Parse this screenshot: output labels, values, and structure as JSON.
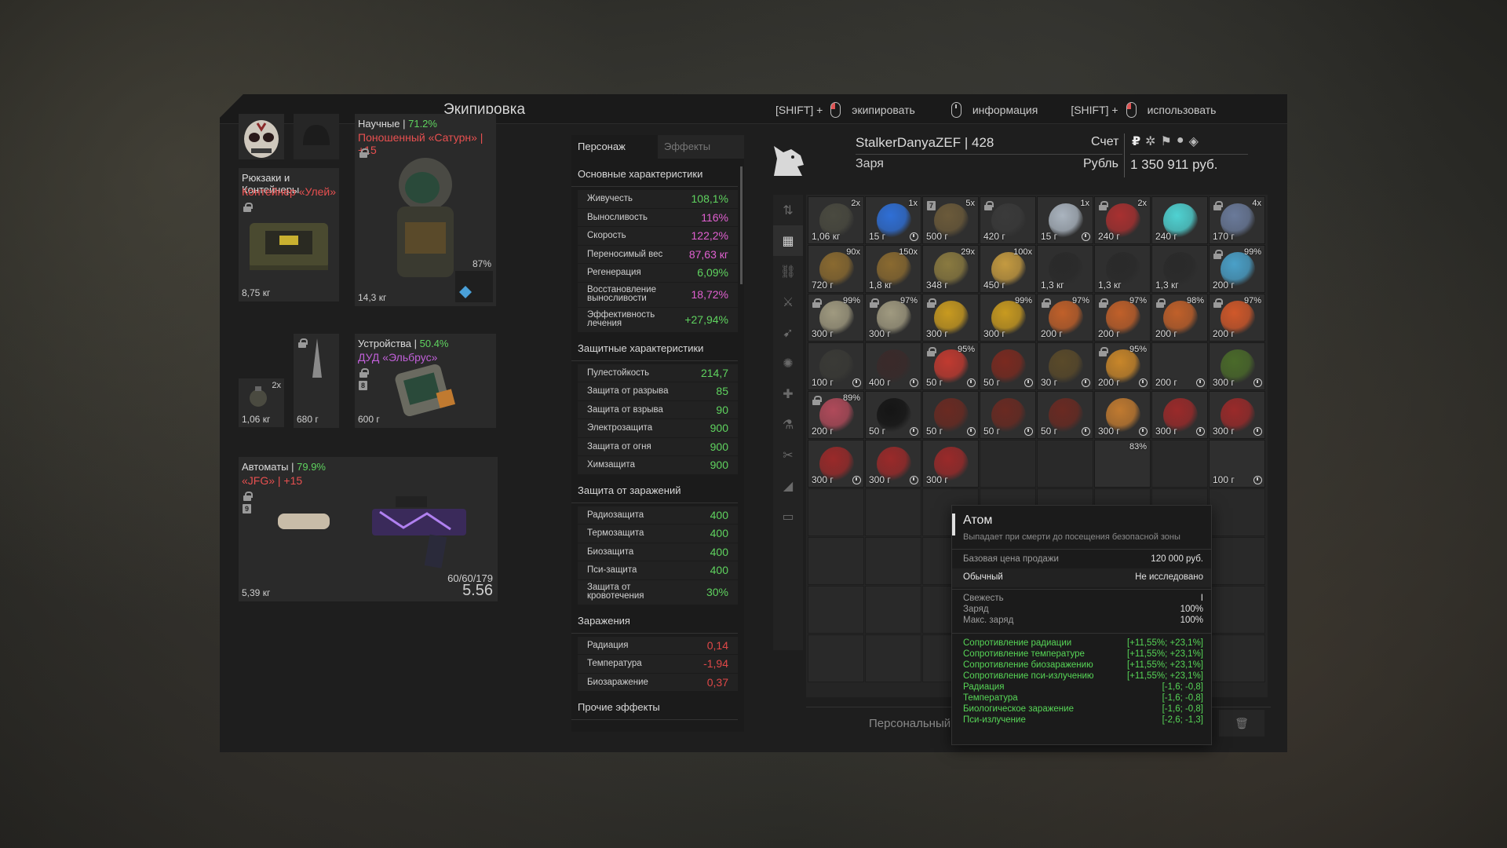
{
  "window": {
    "title": "Экипировка"
  },
  "hints": [
    {
      "prefix": "[SHIFT] +",
      "label": "экипировать",
      "mouse": "left"
    },
    {
      "prefix": "",
      "label": "информация",
      "mouse": "mid"
    },
    {
      "prefix": "[SHIFT] +",
      "label": "использовать",
      "mouse": "left"
    }
  ],
  "equipment": {
    "backpack": {
      "label": "Рюкзаки и Контейнеры",
      "name": "Контейнер «Улей»",
      "weight": "8,75 кг"
    },
    "armor": {
      "label": "Научные",
      "pct": "71.2%",
      "name": "Поношенный «Сатурн» | +15",
      "weight": "14,3 кг",
      "slot_pct": "87%"
    },
    "grenade": {
      "count": "2x",
      "weight": "1,06 кг"
    },
    "knife": {
      "weight": "680 г"
    },
    "device": {
      "label": "Устройства",
      "pct": "50.4%",
      "name": "ДУД «Эльбрус»",
      "badge": "8",
      "weight": "600 г"
    },
    "weapon": {
      "label": "Автоматы",
      "pct": "79.9%",
      "name": "«JFG» | +15",
      "badge": "9",
      "ammo": "60/60/179",
      "caliber": "5.56",
      "weight": "5,39 кг"
    }
  },
  "stats": {
    "tabs": [
      "Персонаж",
      "Эффекты"
    ],
    "main_title": "Основные характеристики",
    "main": [
      {
        "k": "Живучесть",
        "v": "108,1%",
        "c": "green"
      },
      {
        "k": "Выносливость",
        "v": "116%",
        "c": "pink"
      },
      {
        "k": "Скорость",
        "v": "122,2%",
        "c": "pink"
      },
      {
        "k": "Переносимый вес",
        "v": "87,63 кг",
        "c": "pink"
      },
      {
        "k": "Регенерация",
        "v": "6,09%",
        "c": "green"
      },
      {
        "k": "Восстановление выносливости",
        "v": "18,72%",
        "c": "pink",
        "tall": true
      },
      {
        "k": "Эффективность лечения",
        "v": "+27,94%",
        "c": "green",
        "tall": true
      }
    ],
    "prot_title": "Защитные характеристики",
    "prot": [
      {
        "k": "Пулестойкость",
        "v": "214,7"
      },
      {
        "k": "Защита от разрыва",
        "v": "85"
      },
      {
        "k": "Защита от взрыва",
        "v": "90"
      },
      {
        "k": "Электрозащита",
        "v": "900"
      },
      {
        "k": "Защита от огня",
        "v": "900"
      },
      {
        "k": "Химзащита",
        "v": "900"
      }
    ],
    "cont_title": "Защита от заражений",
    "cont": [
      {
        "k": "Радиозащита",
        "v": "400"
      },
      {
        "k": "Термозащита",
        "v": "400"
      },
      {
        "k": "Биозащита",
        "v": "400"
      },
      {
        "k": "Пси-защита",
        "v": "400"
      },
      {
        "k": "Защита от кровотечения",
        "v": "30%",
        "tall": true
      }
    ],
    "inf_title": "Заражения",
    "inf": [
      {
        "k": "Радиация",
        "v": "0,14"
      },
      {
        "k": "Температура",
        "v": "-1,94"
      },
      {
        "k": "Биозаражение",
        "v": "0,37"
      }
    ],
    "other_title": "Прочие эффекты"
  },
  "profile": {
    "name": "StalkerDanyaZEF | 428",
    "faction": "Заря",
    "account_label": "Счет",
    "currency_label": "Рубль",
    "balance": "1 350 911 руб."
  },
  "inventory": [
    [
      {
        "p": "1,06 кг",
        "n": "2x",
        "col": "#4a4a40"
      },
      {
        "p": "15 г",
        "n": "1x",
        "col": "#2f6fd6",
        "clock": true
      },
      {
        "p": "500 г",
        "n": "5x",
        "col": "#6b5a3a",
        "b": "7"
      },
      {
        "p": "420 г",
        "col": "#3a3a3a",
        "lock": true
      },
      {
        "p": "15 г",
        "n": "1x",
        "col": "#aab4bf",
        "clock": true
      },
      {
        "p": "240 г",
        "n": "2x",
        "col": "#a83030",
        "lock": true
      },
      {
        "p": "240 г",
        "col": "#4fd2d2"
      },
      {
        "p": "170 г",
        "n": "4x",
        "col": "#6a7a9a",
        "lock": true
      }
    ],
    [
      {
        "p": "720 г",
        "n": "90x",
        "col": "#8a6a30"
      },
      {
        "p": "1,8 кг",
        "n": "150x",
        "col": "#8a6a30"
      },
      {
        "p": "348 г",
        "n": "29x",
        "col": "#8a7a40"
      },
      {
        "p": "450 г",
        "n": "100x",
        "col": "#c49a40"
      },
      {
        "p": "1,3 кг",
        "col": "#2a2a2a"
      },
      {
        "p": "1,3 кг",
        "col": "#2a2a2a"
      },
      {
        "p": "1,3 кг",
        "col": "#2a2a2a"
      },
      {
        "p": "200 г",
        "n": "99%",
        "col": "#4aa0c8",
        "lock": true
      }
    ],
    [
      {
        "p": "300 г",
        "n": "99%",
        "col": "#a09a80",
        "lock": true
      },
      {
        "p": "300 г",
        "n": "97%",
        "col": "#a09a80",
        "lock": true
      },
      {
        "p": "300 г",
        "col": "#c89a20",
        "lock": true
      },
      {
        "p": "300 г",
        "n": "99%",
        "col": "#c89a20"
      },
      {
        "p": "200 г",
        "n": "97%",
        "col": "#c0602a",
        "lock": true
      },
      {
        "p": "200 г",
        "n": "97%",
        "col": "#c0602a",
        "lock": true
      },
      {
        "p": "200 г",
        "n": "98%",
        "col": "#c0602a",
        "lock": true
      },
      {
        "p": "200 г",
        "n": "97%",
        "col": "#d0582a",
        "lock": true
      }
    ],
    [
      {
        "p": "100 г",
        "col": "#3a3a36",
        "clock": true
      },
      {
        "p": "400 г",
        "col": "#3a2a2a",
        "clock": true
      },
      {
        "p": "50 г",
        "n": "95%",
        "col": "#c03a30",
        "lock": true,
        "clock": true
      },
      {
        "p": "50 г",
        "col": "#7a2a20",
        "clock": true
      },
      {
        "p": "30 г",
        "col": "#5a4a2a",
        "clock": true
      },
      {
        "p": "200 г",
        "n": "95%",
        "col": "#c8862a",
        "lock": true,
        "clock": true
      },
      {
        "p": "200 г",
        "col": "#222",
        "clock": true
      },
      {
        "p": "300 г",
        "col": "#4a6a2a",
        "clock": true
      }
    ],
    [
      {
        "p": "200 г",
        "n": "89%",
        "col": "#b04a5a",
        "lock": true
      },
      {
        "p": "50 г",
        "col": "#151515",
        "clock": true
      },
      {
        "p": "50 г",
        "col": "#6a2a22",
        "clock": true
      },
      {
        "p": "50 г",
        "col": "#6a2a22",
        "clock": true
      },
      {
        "p": "50 г",
        "col": "#6a2a22",
        "clock": true
      },
      {
        "p": "300 г",
        "col": "#c07a30",
        "clock": true
      },
      {
        "p": "300 г",
        "col": "#9a2a2a",
        "clock": true
      },
      {
        "p": "300 г",
        "col": "#9a2a2a",
        "clock": true
      }
    ],
    [
      {
        "p": "300 г",
        "col": "#9a2a2a",
        "clock": true
      },
      {
        "p": "300 г",
        "col": "#9a2a2a",
        "clock": true
      },
      {
        "p": "300 г",
        "col": "#9a2a2a"
      },
      null,
      null,
      {
        "p": "",
        "n": "83%",
        "col": "#444"
      },
      null,
      {
        "p": "100 г",
        "col": "#555",
        "clock": true
      }
    ]
  ],
  "bottom": {
    "personal": "Персональный с"
  },
  "tooltip": {
    "title": "Атом",
    "desc": "Выпадает при смерти до посещения безопасной зоны",
    "base_label": "Базовая цена продажи",
    "base_val": "120 000 руб.",
    "rarity": "Обычный",
    "research": "Не исследовано",
    "props": [
      {
        "k": "Свежесть",
        "v": "I"
      },
      {
        "k": "Заряд",
        "v": "100%"
      },
      {
        "k": "Макс. заряд",
        "v": "100%"
      }
    ],
    "effects": [
      {
        "k": "Сопротивление радиации",
        "v": "[+11,55%; +23,1%]"
      },
      {
        "k": "Сопротивление температуре",
        "v": "[+11,55%; +23,1%]"
      },
      {
        "k": "Сопротивление биозаражению",
        "v": "[+11,55%; +23,1%]"
      },
      {
        "k": "Сопротивление пси-излучению",
        "v": "[+11,55%; +23,1%]"
      },
      {
        "k": "Радиация",
        "v": "[-1,6; -0,8]"
      },
      {
        "k": "Температура",
        "v": "[-1,6; -0,8]"
      },
      {
        "k": "Биологическое заражение",
        "v": "[-1,6; -0,8]"
      },
      {
        "k": "Пси-излучение",
        "v": "[-2,6; -1,3]"
      }
    ]
  }
}
